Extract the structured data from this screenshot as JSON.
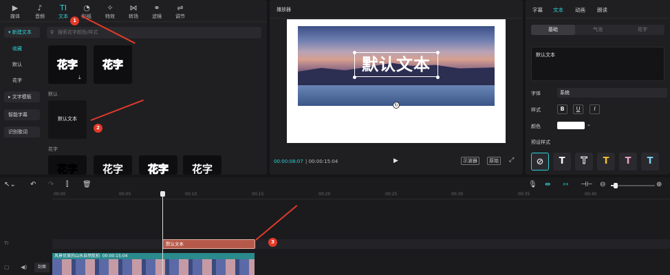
{
  "toolbar": {
    "tabs": [
      {
        "label": "媒体",
        "icon": "media-icon"
      },
      {
        "label": "音频",
        "icon": "audio-icon"
      },
      {
        "label": "文本",
        "icon": "text-icon"
      },
      {
        "label": "贴纸",
        "icon": "sticker-icon"
      },
      {
        "label": "特效",
        "icon": "effects-icon"
      },
      {
        "label": "转场",
        "icon": "transition-icon"
      },
      {
        "label": "滤镜",
        "icon": "filter-icon"
      },
      {
        "label": "调节",
        "icon": "adjust-icon"
      }
    ],
    "active_index": 2
  },
  "sidebar": {
    "items": [
      "新建文本",
      "收藏",
      "默认",
      "花字",
      "文字模板",
      "智能字幕",
      "识别歌词"
    ]
  },
  "search": {
    "placeholder": "搜索花字颜色/样式"
  },
  "library": {
    "huazi_sample": "花字",
    "section_default": "默认",
    "default_text_thumb": "默认文本",
    "section_huazi": "花字"
  },
  "player": {
    "title": "播放器",
    "overlay_text": "默认文本",
    "current_time": "00:00:08:07",
    "total_time": "00:00:15:04",
    "btn_scope": "示波器",
    "btn_ratio": "原始"
  },
  "props": {
    "tabs": [
      "字幕",
      "文本",
      "动画",
      "朗读"
    ],
    "segments": [
      "基础",
      "气泡",
      "花字"
    ],
    "text_value": "默认文本",
    "font_label": "字体",
    "font_value": "系统",
    "style_label": "样式",
    "color_label": "颜色",
    "preset_label": "预设样式",
    "style_buttons": [
      "B",
      "U",
      "I"
    ],
    "presets": [
      "T",
      "T",
      "T",
      "T",
      "T"
    ],
    "preset_colors": [
      "#ffffff",
      "#ffffff",
      "#f2c230",
      "#f0a0c8",
      "#7fd3f0"
    ]
  },
  "timeline": {
    "ticks": [
      "00:00",
      "00:05",
      "00:10",
      "00:15",
      "00:20",
      "00:25",
      "00:30",
      "00:35",
      "00:40"
    ],
    "text_clip": "默认文本",
    "video_clip_name": "风景优美的山水自然航拍",
    "video_clip_duration": "00:00:15:04",
    "track_label_text": "TI",
    "cover_label": "封面"
  },
  "annotations": [
    "1",
    "2",
    "3"
  ],
  "colors": {
    "accent": "#2fd3d8",
    "marker": "#e23a2a"
  }
}
